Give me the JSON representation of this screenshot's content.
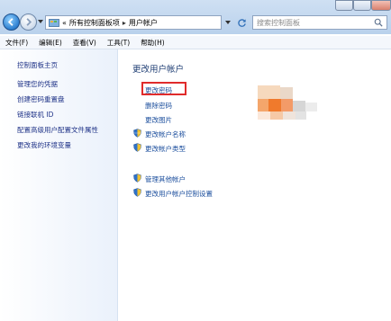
{
  "address": {
    "crumbs": [
      "所有控制面板项",
      "用户帐户"
    ],
    "prefix": "«",
    "separator": "▸"
  },
  "search": {
    "placeholder": "搜索控制面板"
  },
  "menu": [
    "文件(F)",
    "编辑(E)",
    "查看(V)",
    "工具(T)",
    "帮助(H)"
  ],
  "sidebar": {
    "home": "控制面板主页",
    "links": [
      "管理您的凭据",
      "创建密码重置盘",
      "链接联机 ID",
      "配置高级用户配置文件属性",
      "更改我的环境变量"
    ]
  },
  "main": {
    "title": "更改用户帐户",
    "tasks": [
      "更改密码",
      "删除密码",
      "更改图片"
    ],
    "shield_tasks": [
      "更改帐户名称",
      "更改帐户类型"
    ],
    "other_tasks": [
      "管理其他帐户",
      "更改用户帐户控制设置"
    ]
  },
  "colors": {
    "link": "#1a4d9c",
    "highlight": "#e02b2b",
    "title": "#1e3d73"
  }
}
